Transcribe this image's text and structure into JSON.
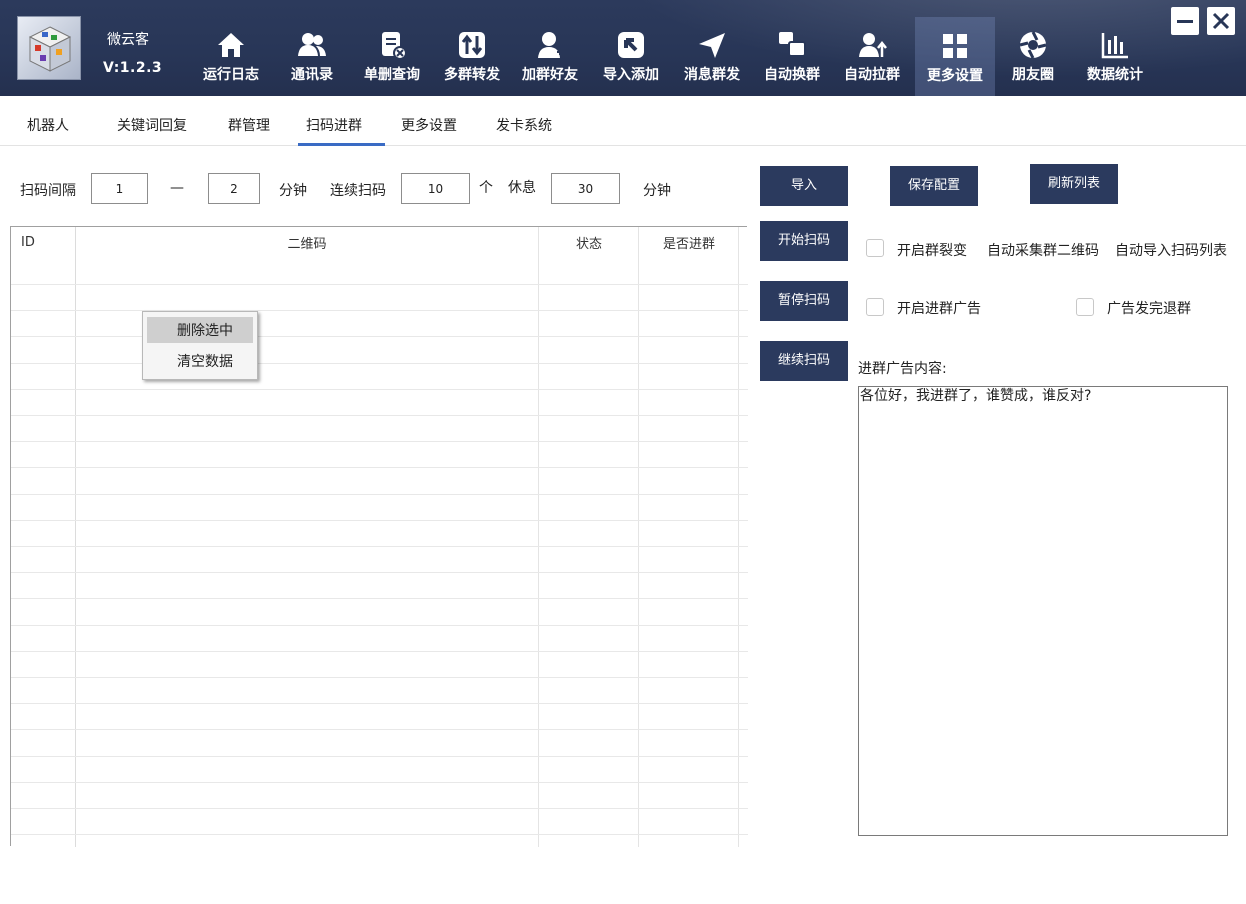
{
  "app": {
    "name": "微云客",
    "version": "V:1.2.3"
  },
  "nav": [
    {
      "label": "运行日志",
      "icon": "home-icon"
    },
    {
      "label": "通讯录",
      "icon": "contacts-icon"
    },
    {
      "label": "单删查询",
      "icon": "delete-check-icon"
    },
    {
      "label": "多群转发",
      "icon": "transfer-icon"
    },
    {
      "label": "加群好友",
      "icon": "add-friend-icon"
    },
    {
      "label": "导入添加",
      "icon": "import-icon"
    },
    {
      "label": "消息群发",
      "icon": "send-icon"
    },
    {
      "label": "自动换群",
      "icon": "switch-group-icon"
    },
    {
      "label": "自动拉群",
      "icon": "pull-group-icon"
    },
    {
      "label": "更多设置",
      "icon": "grid-icon"
    },
    {
      "label": "朋友圈",
      "icon": "aperture-icon"
    },
    {
      "label": "数据统计",
      "icon": "bar-chart-icon"
    }
  ],
  "window": {
    "minimize": "—",
    "close": "✕"
  },
  "tabs": [
    "机器人",
    "关键词回复",
    "群管理",
    "扫码进群",
    "更多设置",
    "发卡系统"
  ],
  "active_tab": "扫码进群",
  "params": {
    "interval_label": "扫码间隔",
    "interval_min": "1",
    "dash": "—",
    "interval_max": "2",
    "unit_minute_1": "分钟",
    "continuous_label": "连续扫码",
    "continuous_count": "10",
    "unit_count": "个",
    "rest_label": "休息",
    "rest_minutes": "30",
    "unit_minute_2": "分钟"
  },
  "table": {
    "headers": {
      "id": "ID",
      "qrcode": "二维码",
      "status": "状态",
      "joined": "是否进群"
    },
    "rows": []
  },
  "context_menu": {
    "delete_selected": "删除选中",
    "clear_data": "清空数据"
  },
  "buttons": {
    "import": "导入",
    "save_config": "保存配置",
    "refresh_list": "刷新列表",
    "start_scan": "开始扫码",
    "pause_scan": "暂停扫码",
    "continue_scan": "继续扫码"
  },
  "options": {
    "group_fission": "开启群裂变",
    "auto_collect": "自动采集群二维码",
    "auto_import": "自动导入扫码列表",
    "join_ad": "开启进群广告",
    "quit_after_ad": "广告发完退群"
  },
  "ad": {
    "label": "进群广告内容:",
    "content": "各位好，我进群了，谁赞成，谁反对?"
  },
  "colors": {
    "header_bg": "#283657",
    "button_bg": "#2b3a5e",
    "tab_accent": "#3a6bc4"
  }
}
